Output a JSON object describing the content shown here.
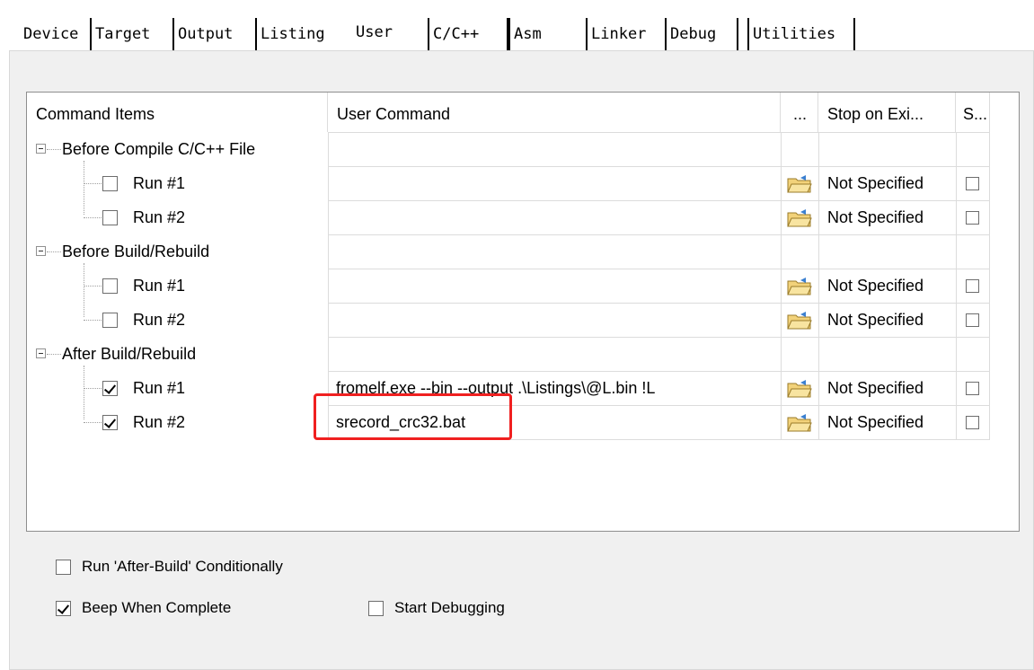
{
  "tabs": [
    {
      "label": "Device"
    },
    {
      "label": "Target"
    },
    {
      "label": "Output"
    },
    {
      "label": "Listing"
    },
    {
      "label": "User"
    },
    {
      "label": "C/C++"
    },
    {
      "label": "Asm"
    },
    {
      "label": "Linker"
    },
    {
      "label": "Debug"
    },
    {
      "label": "Utilities"
    }
  ],
  "active_tab": "User",
  "grid": {
    "headers": {
      "items": "Command Items",
      "command": "User Command",
      "browse": "...",
      "stop": "Stop on Exi...",
      "s": "S..."
    },
    "groups": [
      {
        "label": "Before Compile C/C++ File",
        "runs": [
          {
            "label": "Run #1",
            "checked": false,
            "command": "",
            "stop": "Not Specified"
          },
          {
            "label": "Run #2",
            "checked": false,
            "command": "",
            "stop": "Not Specified"
          }
        ]
      },
      {
        "label": "Before Build/Rebuild",
        "runs": [
          {
            "label": "Run #1",
            "checked": false,
            "command": "",
            "stop": "Not Specified"
          },
          {
            "label": "Run #2",
            "checked": false,
            "command": "",
            "stop": "Not Specified"
          }
        ]
      },
      {
        "label": "After Build/Rebuild",
        "runs": [
          {
            "label": "Run #1",
            "checked": true,
            "command": "fromelf.exe --bin --output .\\Listings\\@L.bin !L",
            "stop": "Not Specified"
          },
          {
            "label": "Run #2",
            "checked": true,
            "command": "srecord_crc32.bat",
            "stop": "Not Specified"
          }
        ]
      }
    ]
  },
  "options": {
    "run_after_build": {
      "label": "Run 'After-Build' Conditionally",
      "checked": false
    },
    "beep": {
      "label": "Beep When Complete",
      "checked": true
    },
    "start_debug": {
      "label": "Start Debugging",
      "checked": false
    }
  },
  "colors": {
    "highlight": "#f02020",
    "panel": "#f0f0f0"
  }
}
